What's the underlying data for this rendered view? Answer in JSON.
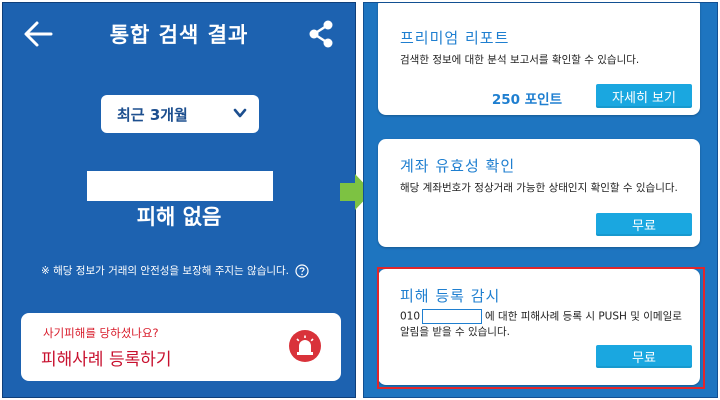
{
  "left": {
    "header": {
      "title": "통합 검색 결과",
      "back_icon": "arrow-left-icon",
      "share_icon": "share-icon"
    },
    "period_select": {
      "selected": "최근 3개월"
    },
    "result": {
      "text": "피해 없음"
    },
    "notice": {
      "text": "※ 해당 정보가 거래의 안전성을 보장해 주지는 않습니다."
    },
    "report_card": {
      "question": "사기피해를 당하셨나요?",
      "cta": "피해사례 등록하기",
      "siren_color": "#d9323a"
    }
  },
  "right": {
    "cards": [
      {
        "title": "프리미엄 리포트",
        "description": "검색한 정보에 대한 분석 보고서를 확인할 수 있습니다.",
        "points": "250 포인트",
        "button": "자세히 보기"
      },
      {
        "title": "계좌 유효성 확인",
        "description": "해당 계좌번호가 정상거래 가능한 상태인지 확인할 수 있습니다.",
        "button": "무료"
      },
      {
        "title": "피해 등록 감시",
        "phone_prefix": "010",
        "description": "에 대한 피해사례 등록 시 PUSH 및 이메일로 알림을 받을 수 있습니다.",
        "button": "무료"
      }
    ]
  },
  "colors": {
    "left_bg": "#1d62b0",
    "right_bg": "#1e75c0",
    "accent_button": "#1aa7e0",
    "highlight_border": "#e2262a",
    "arrow": "#7dc242"
  }
}
